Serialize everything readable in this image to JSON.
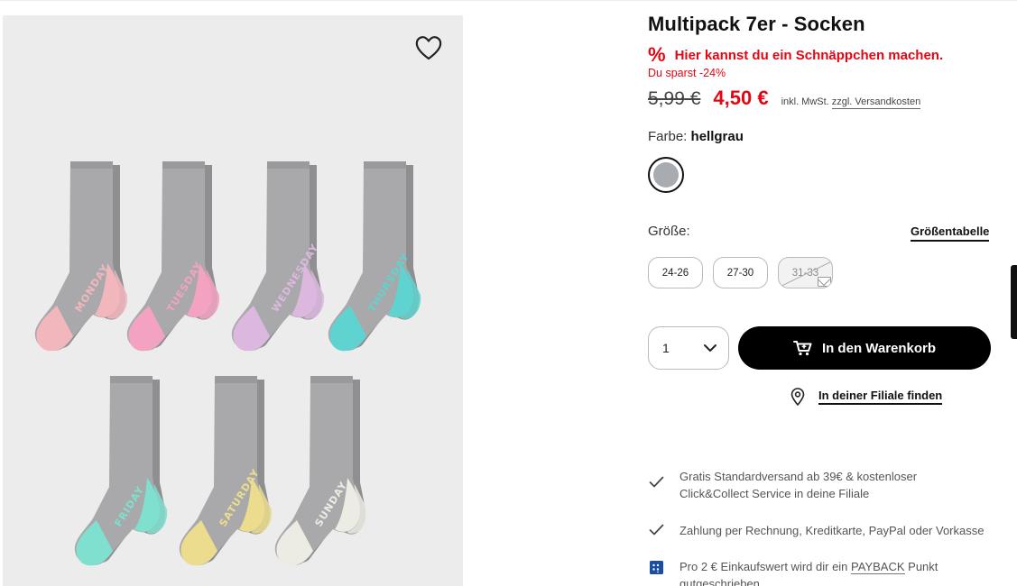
{
  "product": {
    "title": "Multipack 7er - Socken",
    "deal_icon": "%",
    "deal_text": "Hier kannst du ein Schnäppchen machen.",
    "savings": "Du sparst -24%",
    "old_price": "5,99 €",
    "new_price": "4,50 €",
    "tax_note": "inkl. MwSt.",
    "shipping_link": "zzgl. Versandkosten",
    "color_label": "Farbe:",
    "color_value": "hellgrau",
    "color_swatch": "#a8abb0",
    "size_label": "Größe:",
    "size_table_link": "Größentabelle",
    "sizes": [
      {
        "label": "24-26",
        "available": true
      },
      {
        "label": "27-30",
        "available": true
      },
      {
        "label": "31-33",
        "available": false
      }
    ],
    "quantity": "1",
    "add_to_cart": "In den Warenkorb",
    "find_in_store": "In deiner Filiale finden"
  },
  "benefits": [
    {
      "icon": "check-icon",
      "text": "Gratis Standardversand ab 39€ & kostenloser Click&Collect Service in deine Filiale"
    },
    {
      "icon": "check-icon",
      "text": "Zahlung per Rechnung, Kreditkarte, PayPal oder Vorkasse"
    },
    {
      "icon": "payback-icon",
      "text_before": "Pro 2 € Einkaufswert wird dir ein",
      "link": "PAYBACK",
      "text_after": "Punkt gutgeschrieben"
    }
  ],
  "gallery": {
    "wishlist_icon": "heart-icon",
    "socks": [
      {
        "day": "MONDAY",
        "accent": "#f2b7bd"
      },
      {
        "day": "TUESDAY",
        "accent": "#f3a2c2"
      },
      {
        "day": "WEDNESDAY",
        "accent": "#dcb8df"
      },
      {
        "day": "THURSDAY",
        "accent": "#5fd3cf"
      },
      {
        "day": "FRIDAY",
        "accent": "#7fe0cf"
      },
      {
        "day": "SATURDAY",
        "accent": "#ecdd8e"
      },
      {
        "day": "SUNDAY",
        "accent": "#ecece4"
      }
    ]
  },
  "colors": {
    "sale": "#e30613",
    "primary": "#000000",
    "sock_grey": "#a9a9ab"
  }
}
